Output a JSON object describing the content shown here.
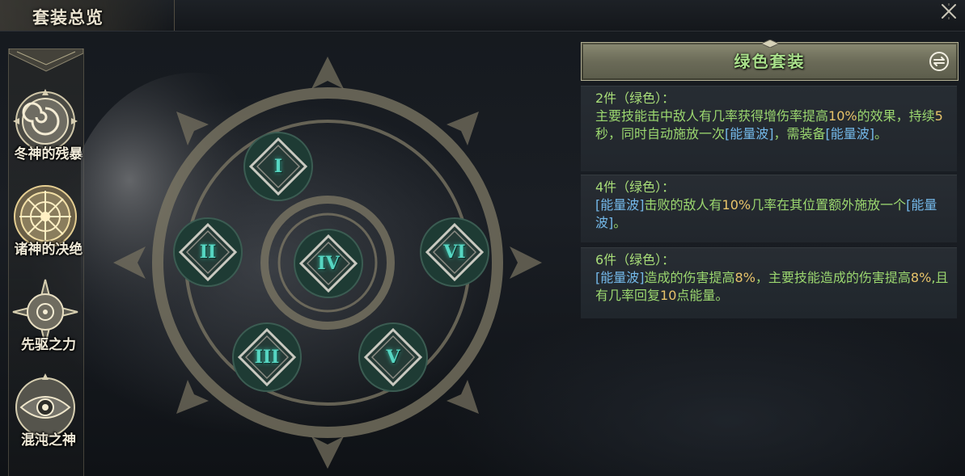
{
  "header": {
    "title": "套装总览"
  },
  "sidebar": {
    "items": [
      {
        "label": "冬神的残暴",
        "icon": "spiral-rose-emblem-icon"
      },
      {
        "label": "诸神的决绝",
        "icon": "clockwork-sun-emblem-icon"
      },
      {
        "label": "先驱之力",
        "icon": "star-compass-emblem-icon"
      },
      {
        "label": "混沌之神",
        "icon": "eye-emblem-icon"
      }
    ]
  },
  "emblem": {
    "nodes": [
      {
        "numeral": "I"
      },
      {
        "numeral": "II"
      },
      {
        "numeral": "IV"
      },
      {
        "numeral": "VI"
      },
      {
        "numeral": "III"
      },
      {
        "numeral": "V"
      }
    ]
  },
  "panel": {
    "title": "绿色套装",
    "tiers": [
      {
        "heading": "2件（绿色）：",
        "parts": [
          {
            "t": "主要技能击中敌人有几率获得增伤率提高",
            "c": ""
          },
          {
            "t": "10%",
            "c": "hl-num"
          },
          {
            "t": "的效果，持续",
            "c": ""
          },
          {
            "t": "5",
            "c": "hl-num"
          },
          {
            "t": "秒，同时自动施放一次",
            "c": ""
          },
          {
            "t": "[能量波]",
            "c": "hl-skill"
          },
          {
            "t": "，需装备",
            "c": ""
          },
          {
            "t": "[能量波]",
            "c": "hl-skill"
          },
          {
            "t": "。",
            "c": ""
          }
        ]
      },
      {
        "heading": "4件（绿色）：",
        "parts": [
          {
            "t": "[能量波]",
            "c": "hl-skill"
          },
          {
            "t": "击败的敌人有",
            "c": ""
          },
          {
            "t": "10%",
            "c": "hl-num"
          },
          {
            "t": "几率在其位置额外施放一个",
            "c": ""
          },
          {
            "t": "[能量波]",
            "c": "hl-skill"
          },
          {
            "t": "。",
            "c": ""
          }
        ]
      },
      {
        "heading": "6件（绿色）：",
        "parts": [
          {
            "t": "[能量波]",
            "c": "hl-skill"
          },
          {
            "t": "造成的伤害提高",
            "c": ""
          },
          {
            "t": "8%",
            "c": "hl-num"
          },
          {
            "t": "，主要技能造成的伤害提高",
            "c": ""
          },
          {
            "t": "8%",
            "c": "hl-num"
          },
          {
            "t": ",且有几率回复",
            "c": ""
          },
          {
            "t": "10",
            "c": "hl-num"
          },
          {
            "t": "点能量。",
            "c": ""
          }
        ]
      }
    ]
  },
  "colors": {
    "accent_green": "#9bd76f",
    "number_gold": "#e8c46a",
    "skill_blue": "#74b9ea",
    "numeral_teal": "#56d6c2"
  }
}
